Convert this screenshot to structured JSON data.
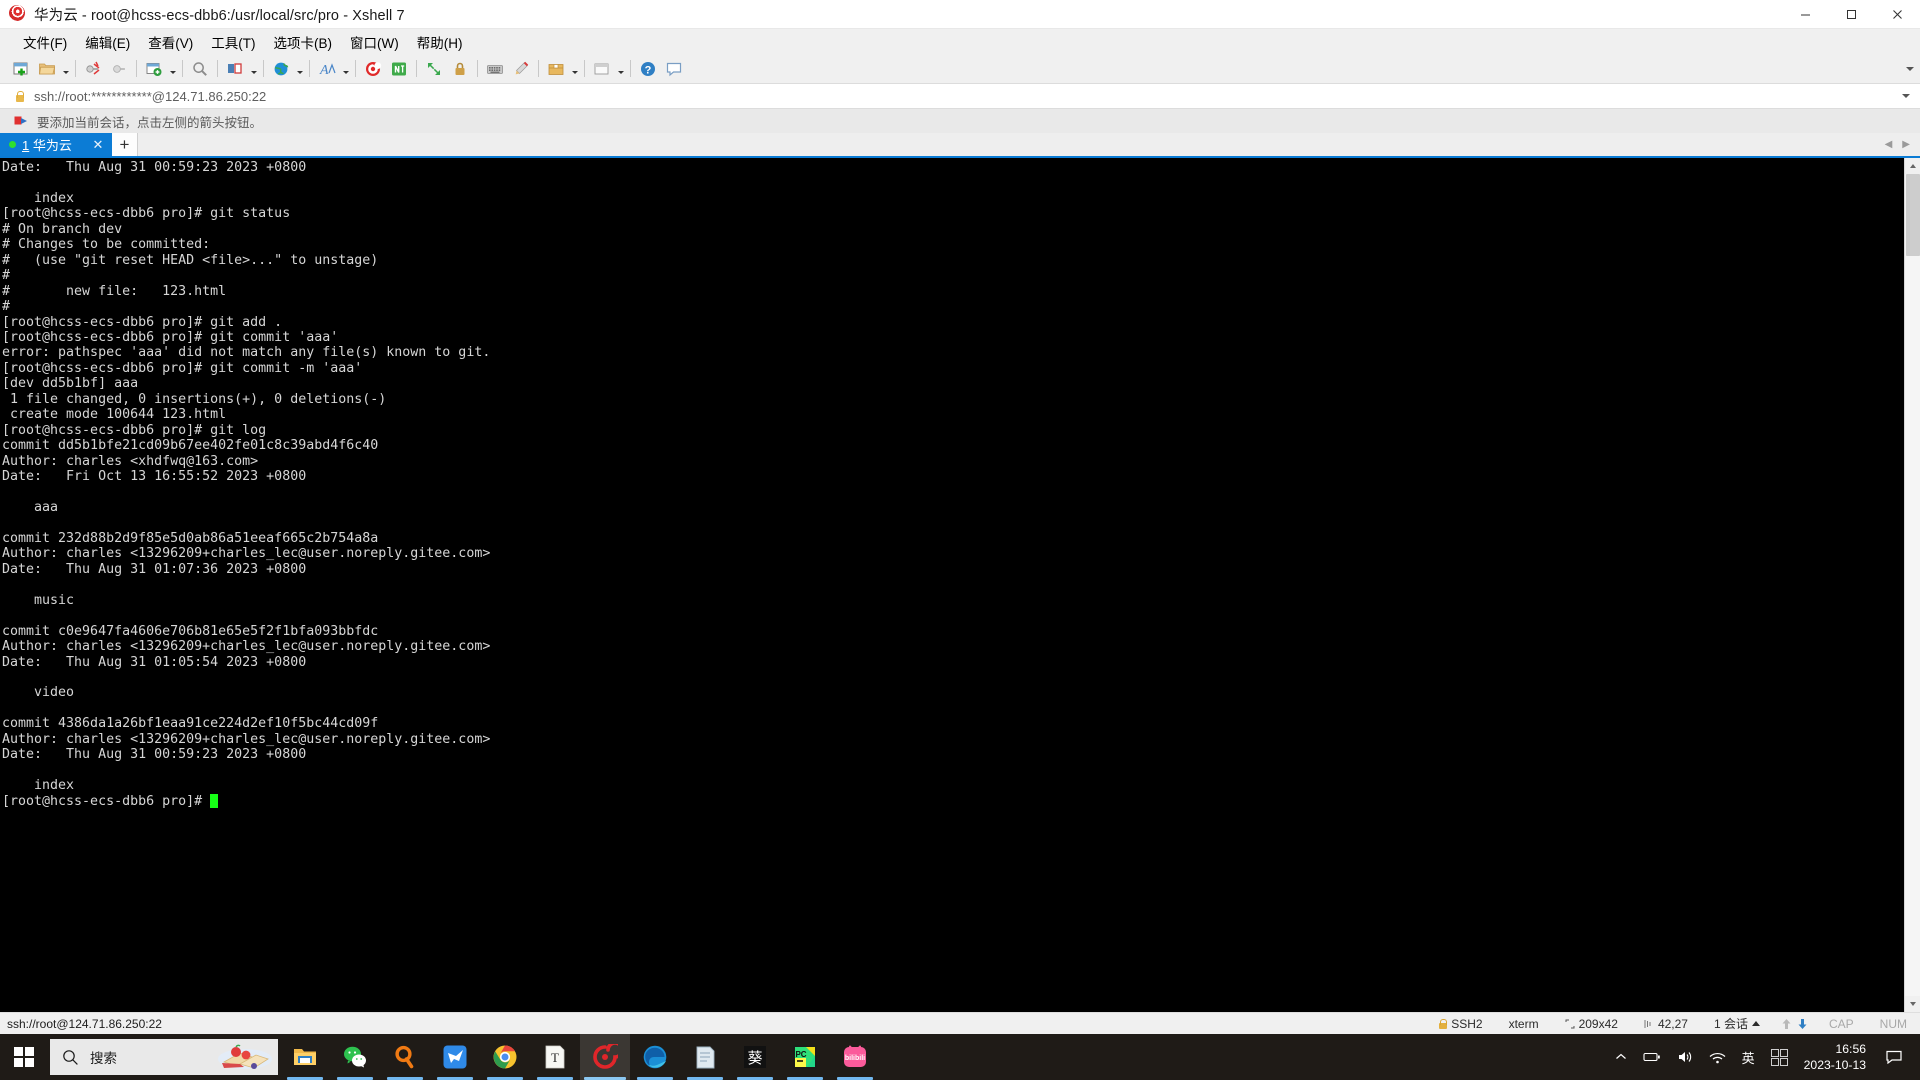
{
  "window": {
    "title": "华为云 - root@hcss-ecs-dbb6:/usr/local/src/pro - Xshell 7",
    "minimize_label": "—",
    "maximize_label": "▢",
    "close_label": "✕"
  },
  "menubar": {
    "items": [
      {
        "label": "文件(F)",
        "name": "menu-file"
      },
      {
        "label": "编辑(E)",
        "name": "menu-edit"
      },
      {
        "label": "查看(V)",
        "name": "menu-view"
      },
      {
        "label": "工具(T)",
        "name": "menu-tools"
      },
      {
        "label": "选项卡(B)",
        "name": "menu-tabs"
      },
      {
        "label": "窗口(W)",
        "name": "menu-window"
      },
      {
        "label": "帮助(H)",
        "name": "menu-help"
      }
    ]
  },
  "toolbar": {
    "icons": [
      "new-session-icon",
      "open-folder-icon",
      "reconnect-icon",
      "disconnect-icon",
      "new-tab-icon",
      "find-icon",
      "layout-icon",
      "transfer-icon",
      "font-icon",
      "xshell-icon",
      "xftp-icon",
      "fullscreen-icon",
      "lock-icon",
      "keyboard-icon",
      "highlight-icon",
      "package-icon",
      "compose-icon",
      "help-icon",
      "chat-icon"
    ],
    "overflow_label": "▾"
  },
  "address_bar": {
    "value": "ssh://root:************@124.71.86.250:22",
    "lock_icon": "lock-icon",
    "dropdown_icon": "chevron-down-icon"
  },
  "notice": {
    "icon": "flag-icon",
    "text": "要添加当前会话，点击左侧的箭头按钮。"
  },
  "tabs": {
    "active": {
      "number": "1",
      "label": "华为云",
      "status_dot": "connected",
      "close_label": "✕"
    },
    "add_label": "+",
    "nav_left": "◀",
    "nav_right": "▶"
  },
  "terminal": {
    "lines": [
      "Date:   Thu Aug 31 00:59:23 2023 +0800",
      "",
      "    index",
      "[root@hcss-ecs-dbb6 pro]# git status",
      "# On branch dev",
      "# Changes to be committed:",
      "#   (use \"git reset HEAD <file>...\" to unstage)",
      "#",
      "#       new file:   123.html",
      "#",
      "[root@hcss-ecs-dbb6 pro]# git add .",
      "[root@hcss-ecs-dbb6 pro]# git commit 'aaa'",
      "error: pathspec 'aaa' did not match any file(s) known to git.",
      "[root@hcss-ecs-dbb6 pro]# git commit -m 'aaa'",
      "[dev dd5b1bf] aaa",
      " 1 file changed, 0 insertions(+), 0 deletions(-)",
      " create mode 100644 123.html",
      "[root@hcss-ecs-dbb6 pro]# git log",
      "commit dd5b1bfe21cd09b67ee402fe01c8c39abd4f6c40",
      "Author: charles <xhdfwq@163.com>",
      "Date:   Fri Oct 13 16:55:52 2023 +0800",
      "",
      "    aaa",
      "",
      "commit 232d88b2d9f85e5d0ab86a51eeaf665c2b754a8a",
      "Author: charles <13296209+charles_lec@user.noreply.gitee.com>",
      "Date:   Thu Aug 31 01:07:36 2023 +0800",
      "",
      "    music",
      "",
      "commit c0e9647fa4606e706b81e65e5f2f1bfa093bbfdc",
      "Author: charles <13296209+charles_lec@user.noreply.gitee.com>",
      "Date:   Thu Aug 31 01:05:54 2023 +0800",
      "",
      "    video",
      "",
      "commit 4386da1a26bf1eaa91ce224d2ef10f5bc44cd09f",
      "Author: charles <13296209+charles_lec@user.noreply.gitee.com>",
      "Date:   Thu Aug 31 00:59:23 2023 +0800",
      "",
      "    index"
    ],
    "prompt": "[root@hcss-ecs-dbb6 pro]# ",
    "cursor_color": "#16ff16",
    "background": "#000000",
    "foreground": "#d6d6d6"
  },
  "statusbar": {
    "connection": "ssh://root@124.71.86.250:22",
    "protocol": "SSH2",
    "terminal_type": "xterm",
    "size": "209x42",
    "cursor_pos": "42,27",
    "sessions": "1 会话",
    "cap": "CAP",
    "num": "NUM"
  },
  "taskbar": {
    "start_label": "start-icon",
    "search_placeholder": "搜索",
    "apps": [
      {
        "name": "taskbar-file-explorer",
        "label": "文件资源管理器"
      },
      {
        "name": "taskbar-wechat",
        "label": "微信"
      },
      {
        "name": "taskbar-everything",
        "label": "Everything"
      },
      {
        "name": "taskbar-bird-app",
        "label": "应用"
      },
      {
        "name": "taskbar-chrome",
        "label": "Google Chrome"
      },
      {
        "name": "taskbar-typora",
        "label": "Typora"
      },
      {
        "name": "taskbar-xshell",
        "label": "Xshell 7"
      },
      {
        "name": "taskbar-edge",
        "label": "Microsoft Edge"
      },
      {
        "name": "taskbar-notes",
        "label": "备忘录"
      },
      {
        "name": "taskbar-sunlogin",
        "label": "葵"
      },
      {
        "name": "taskbar-pycharm",
        "label": "PyCharm"
      },
      {
        "name": "taskbar-bilibili",
        "label": "bilibili"
      }
    ],
    "tray": {
      "overflow": "︿",
      "ime_label": "英",
      "time": "16:56",
      "date": "2023-10-13"
    }
  }
}
